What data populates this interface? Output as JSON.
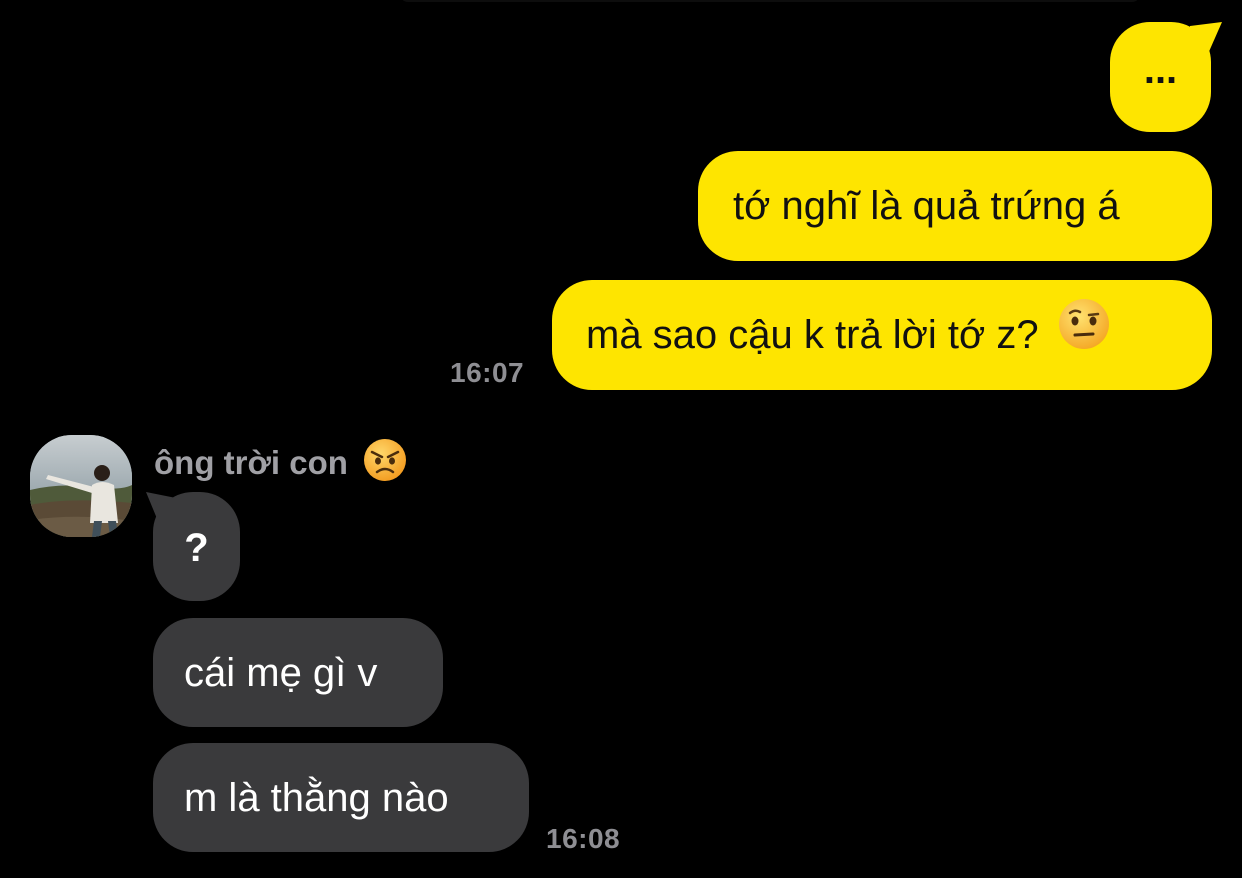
{
  "conversation": {
    "outgoing": [
      {
        "text": "..."
      },
      {
        "text": "tớ nghĩ là quả trứng á"
      },
      {
        "text": "mà sao cậu k trả lời tớ z?",
        "emoji": "raised-eyebrow-face-icon"
      }
    ],
    "outgoing_time": "16:07",
    "sender": {
      "name": "ông trời con",
      "emoji": "angry-face-icon"
    },
    "incoming": [
      {
        "text": "?"
      },
      {
        "text": "cái mẹ gì v"
      },
      {
        "text": "m là thằng nào"
      }
    ],
    "incoming_time": "16:08"
  },
  "colors": {
    "background": "#000000",
    "outgoing_bubble": "#fee500",
    "incoming_bubble": "#3a3a3c",
    "timestamp": "#8e8e93",
    "sender_name": "#a0a0a5"
  }
}
